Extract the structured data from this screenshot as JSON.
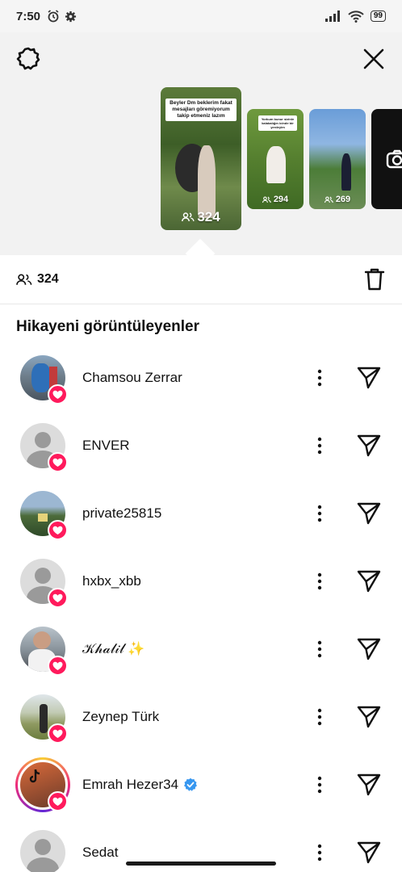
{
  "status_bar": {
    "time": "7:50",
    "battery": "99"
  },
  "stories": [
    {
      "count": "324",
      "caption": "Beyler Dm beklerim fakat mesajları göremiyorum takip etmeniz lazım"
    },
    {
      "count": "294",
      "caption": "Yorkum bunur sizinle kalabalığın icinde bir yerdeyim"
    },
    {
      "count": "269"
    }
  ],
  "viewer_count": "324",
  "section_title": "Hikayeni görüntüleyenler",
  "viewers": [
    {
      "name": "Chamsou Zerrar"
    },
    {
      "name": "ENVER"
    },
    {
      "name": "private25815"
    },
    {
      "name": "hxbx_xbb"
    },
    {
      "name": "𝒦𝒽𝒶𝓁𝒾𝓁 ✨"
    },
    {
      "name": "Zeynep Türk"
    },
    {
      "name": "Emrah Hezer34"
    },
    {
      "name": "Sedat"
    }
  ],
  "colors": {
    "heart_badge": "#ff1a5c",
    "verified": "#3797f0",
    "top_bg": "#f2f2f2"
  }
}
